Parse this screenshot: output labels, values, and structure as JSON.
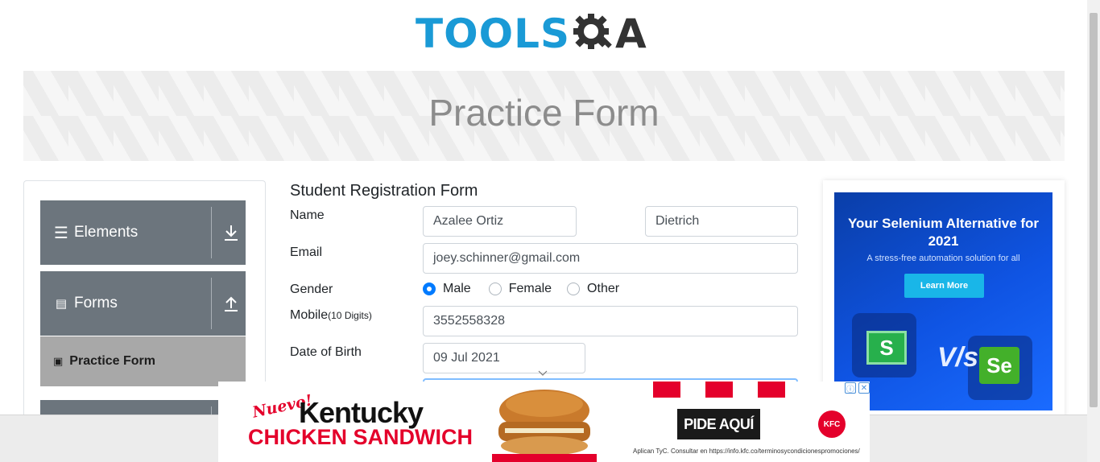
{
  "header": {
    "logo_tools": "TOOLS",
    "logo_a": "A"
  },
  "banner": {
    "title": "Practice Form"
  },
  "sidebar": {
    "groups": [
      {
        "label": "Elements",
        "icon": "hamburger-icon",
        "expanded": false
      },
      {
        "label": "Forms",
        "icon": "document-icon",
        "expanded": true
      }
    ],
    "active_item": {
      "label": "Practice Form",
      "icon": "form-icon"
    }
  },
  "form": {
    "title": "Student Registration Form",
    "name_label": "Name",
    "first_name": "Azalee Ortiz",
    "last_name": "Dietrich",
    "email_label": "Email",
    "email": "joey.schinner@gmail.com",
    "gender_label": "Gender",
    "gender_options": [
      "Male",
      "Female",
      "Other"
    ],
    "gender_selected": "Male",
    "mobile_label": "Mobile",
    "mobile_hint": "(10 Digits)",
    "mobile": "3552558328",
    "dob_label": "Date of Birth",
    "dob": "09 Jul 2021"
  },
  "right_ad": {
    "headline": "Your Selenium Alternative for 2021",
    "subline": "A stress-free automation solution for all",
    "button": "Learn More",
    "vs": "V/s",
    "left_logo": "S",
    "right_logo": "Se"
  },
  "bottom_ad": {
    "nuevo": "Nuevo!",
    "kentucky": "Kentucky",
    "chicken": "CHICKEN SANDWICH",
    "cta": "PIDE AQUÍ",
    "legal": "Aplican TyC. Consultar en https://info.kfc.co/terminosycondicionespromociones/",
    "brand": "KFC",
    "info_icon": "ⓘ",
    "close_icon": "✕"
  },
  "colors": {
    "accent": "#007bff",
    "sidebar_bg": "#6c757d",
    "active_item_bg": "#a8a8a8",
    "kfc_red": "#e4002b"
  }
}
